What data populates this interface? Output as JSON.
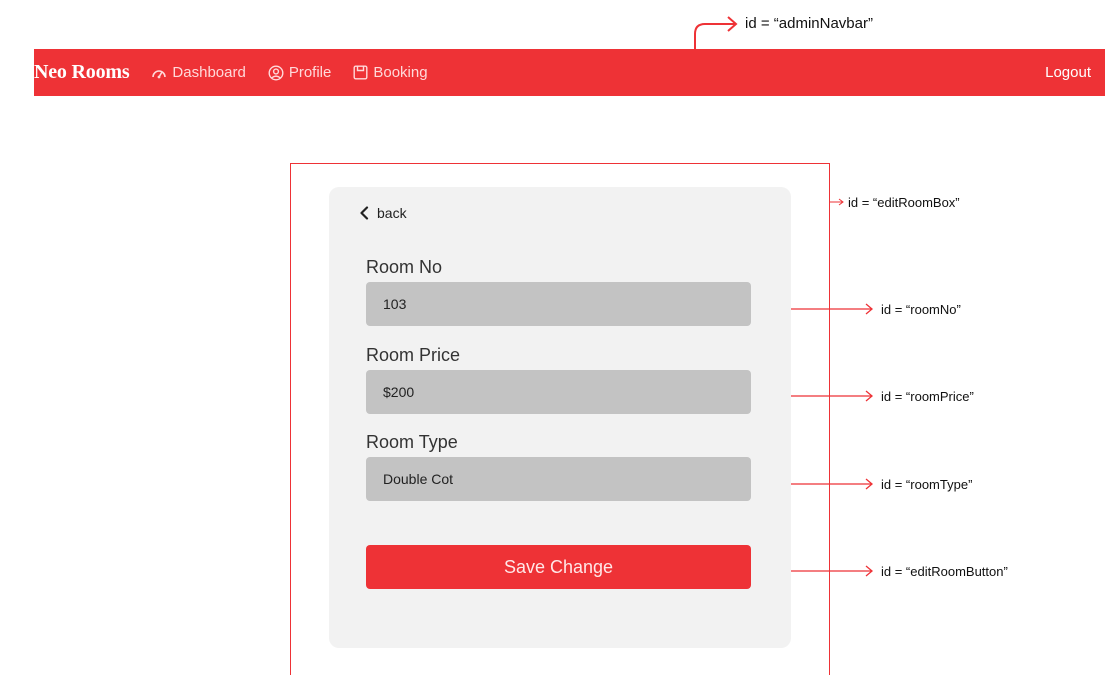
{
  "navbar": {
    "brand": "Neo Rooms",
    "items": [
      {
        "label": "Dashboard",
        "icon": "speedometer-icon"
      },
      {
        "label": "Profile",
        "icon": "user-circle-icon"
      },
      {
        "label": "Booking",
        "icon": "calendar-icon"
      }
    ],
    "logout": "Logout"
  },
  "edit_room": {
    "back_label": "back",
    "fields": {
      "room_no": {
        "label": "Room No",
        "value": "103"
      },
      "room_price": {
        "label": "Room Price",
        "value": "$200"
      },
      "room_type": {
        "label": "Room Type",
        "value": "Double Cot"
      }
    },
    "save_label": "Save Change"
  },
  "annotations": {
    "admin_navbar": "id = “adminNavbar”",
    "edit_room_box": "id = “editRoomBox”",
    "room_no": "id = “roomNo”",
    "room_price": "id = “roomPrice”",
    "room_type": "id = “roomType”",
    "edit_room_button": "id = “editRoomButton”"
  },
  "colors": {
    "accent": "#ee3236",
    "input_bg": "#c3c3c3",
    "card_bg": "#f2f2f2"
  }
}
